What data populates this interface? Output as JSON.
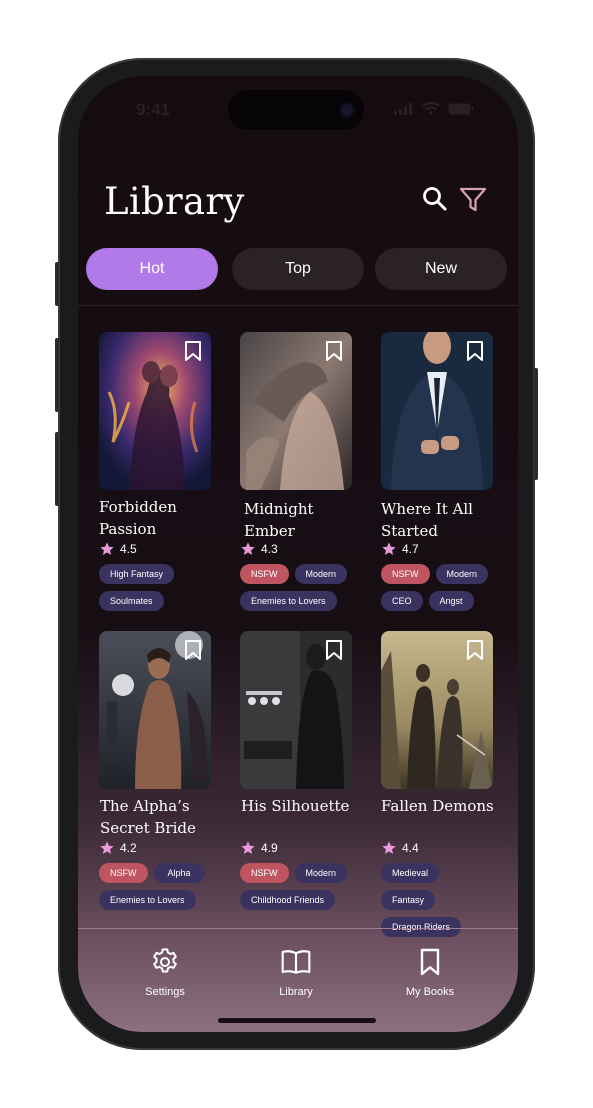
{
  "status_bar": {
    "time": "9:41"
  },
  "header": {
    "title": "Library",
    "search_icon": "search-icon",
    "filter_icon": "filter-icon"
  },
  "tabs": [
    {
      "label": "Hot",
      "active": true
    },
    {
      "label": "Top",
      "active": false
    },
    {
      "label": "New",
      "active": false
    }
  ],
  "books": [
    {
      "title_line1": "Forbidden",
      "title_line2": "Passion",
      "rating": "4.5",
      "tags": [
        "High Fantasy",
        "Soulmates"
      ]
    },
    {
      "title_line1": "Midnight",
      "title_line2": "Ember",
      "rating": "4.3",
      "tags": [
        "NSFW",
        "Modern",
        "Enemies to Lovers"
      ]
    },
    {
      "title_line1": "Where It All",
      "title_line2": "Started",
      "rating": "4.7",
      "tags": [
        "NSFW",
        "Modern",
        "CEO",
        "Angst"
      ]
    },
    {
      "title_line1": "The Alpha’s",
      "title_line2": "Secret Bride",
      "rating": "4.2",
      "tags": [
        "NSFW",
        "Alpha",
        "Enemies to Lovers"
      ]
    },
    {
      "title_line1": "His Silhouette",
      "title_line2": "",
      "rating": "4.9",
      "tags": [
        "NSFW",
        "Modern",
        "Childhood Friends"
      ]
    },
    {
      "title_line1": "Fallen Demons",
      "title_line2": "",
      "rating": "4.4",
      "tags": [
        "Medieval",
        "Fantasy",
        "Dragon Riders"
      ]
    }
  ],
  "bottom_nav": [
    {
      "label": "Settings",
      "icon": "gear-icon"
    },
    {
      "label": "Library",
      "icon": "book-open-icon"
    },
    {
      "label": "My Books",
      "icon": "bookmark-icon"
    }
  ],
  "colors": {
    "accent": "#b27ae8",
    "nsfw_tag": "#bf5560",
    "tag": "#3a3360",
    "star": "#e89ad8",
    "background": "#150c12"
  }
}
